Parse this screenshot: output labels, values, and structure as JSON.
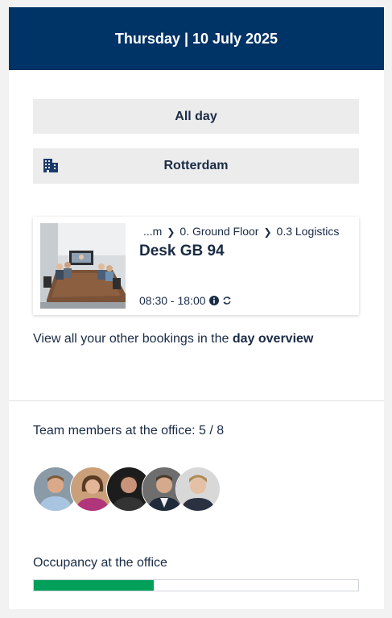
{
  "header": {
    "date_label": "Thursday | 10 July 2025"
  },
  "filters": {
    "time_label": "All day",
    "location_label": "Rotterdam",
    "location_icon": "building-icon"
  },
  "booking": {
    "breadcrumb": [
      "...m",
      "0. Ground Floor",
      "0.3 Logistics"
    ],
    "title": "Desk GB 94",
    "time": "08:30 - 18:00",
    "icons": [
      "info-icon",
      "recurring-icon"
    ]
  },
  "overview": {
    "text": "View all your other bookings in the ",
    "link": "day overview"
  },
  "team": {
    "label": "Team members at the office: 5 / 8",
    "present": 5,
    "total": 8
  },
  "occupancy": {
    "label": "Occupancy at the office",
    "fraction": 0.37
  },
  "colors": {
    "header_bg": "#003366",
    "bar_fill": "#00a05a",
    "pill_bg": "#ececec"
  }
}
